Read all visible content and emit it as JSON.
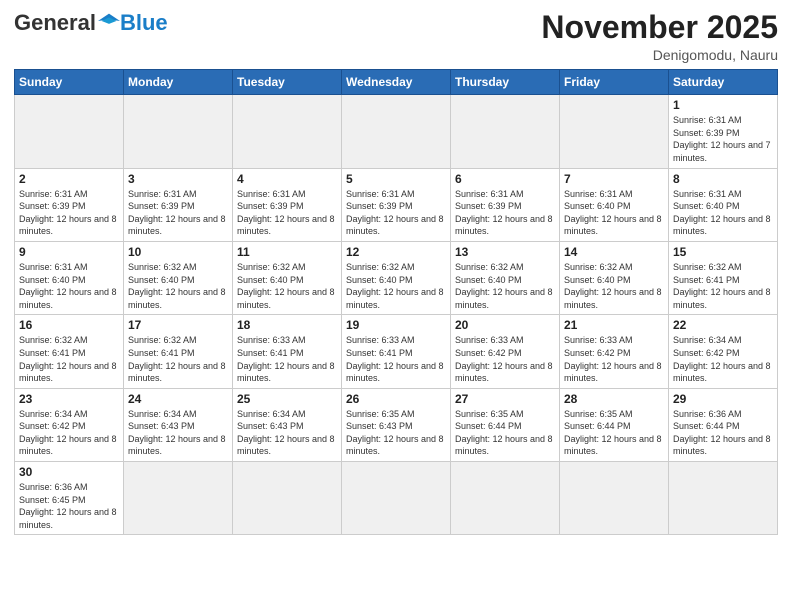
{
  "header": {
    "logo": {
      "general": "General",
      "blue": "Blue"
    },
    "title": "November 2025",
    "location": "Denigomodu, Nauru"
  },
  "weekdays": [
    "Sunday",
    "Monday",
    "Tuesday",
    "Wednesday",
    "Thursday",
    "Friday",
    "Saturday"
  ],
  "weeks": [
    [
      {
        "day": "",
        "info": ""
      },
      {
        "day": "",
        "info": ""
      },
      {
        "day": "",
        "info": ""
      },
      {
        "day": "",
        "info": ""
      },
      {
        "day": "",
        "info": ""
      },
      {
        "day": "",
        "info": ""
      },
      {
        "day": "1",
        "info": "Sunrise: 6:31 AM\nSunset: 6:39 PM\nDaylight: 12 hours\nand 7 minutes."
      }
    ],
    [
      {
        "day": "2",
        "info": "Sunrise: 6:31 AM\nSunset: 6:39 PM\nDaylight: 12 hours\nand 8 minutes."
      },
      {
        "day": "3",
        "info": "Sunrise: 6:31 AM\nSunset: 6:39 PM\nDaylight: 12 hours\nand 8 minutes."
      },
      {
        "day": "4",
        "info": "Sunrise: 6:31 AM\nSunset: 6:39 PM\nDaylight: 12 hours\nand 8 minutes."
      },
      {
        "day": "5",
        "info": "Sunrise: 6:31 AM\nSunset: 6:39 PM\nDaylight: 12 hours\nand 8 minutes."
      },
      {
        "day": "6",
        "info": "Sunrise: 6:31 AM\nSunset: 6:39 PM\nDaylight: 12 hours\nand 8 minutes."
      },
      {
        "day": "7",
        "info": "Sunrise: 6:31 AM\nSunset: 6:40 PM\nDaylight: 12 hours\nand 8 minutes."
      },
      {
        "day": "8",
        "info": "Sunrise: 6:31 AM\nSunset: 6:40 PM\nDaylight: 12 hours\nand 8 minutes."
      }
    ],
    [
      {
        "day": "9",
        "info": "Sunrise: 6:31 AM\nSunset: 6:40 PM\nDaylight: 12 hours\nand 8 minutes."
      },
      {
        "day": "10",
        "info": "Sunrise: 6:32 AM\nSunset: 6:40 PM\nDaylight: 12 hours\nand 8 minutes."
      },
      {
        "day": "11",
        "info": "Sunrise: 6:32 AM\nSunset: 6:40 PM\nDaylight: 12 hours\nand 8 minutes."
      },
      {
        "day": "12",
        "info": "Sunrise: 6:32 AM\nSunset: 6:40 PM\nDaylight: 12 hours\nand 8 minutes."
      },
      {
        "day": "13",
        "info": "Sunrise: 6:32 AM\nSunset: 6:40 PM\nDaylight: 12 hours\nand 8 minutes."
      },
      {
        "day": "14",
        "info": "Sunrise: 6:32 AM\nSunset: 6:40 PM\nDaylight: 12 hours\nand 8 minutes."
      },
      {
        "day": "15",
        "info": "Sunrise: 6:32 AM\nSunset: 6:41 PM\nDaylight: 12 hours\nand 8 minutes."
      }
    ],
    [
      {
        "day": "16",
        "info": "Sunrise: 6:32 AM\nSunset: 6:41 PM\nDaylight: 12 hours\nand 8 minutes."
      },
      {
        "day": "17",
        "info": "Sunrise: 6:32 AM\nSunset: 6:41 PM\nDaylight: 12 hours\nand 8 minutes."
      },
      {
        "day": "18",
        "info": "Sunrise: 6:33 AM\nSunset: 6:41 PM\nDaylight: 12 hours\nand 8 minutes."
      },
      {
        "day": "19",
        "info": "Sunrise: 6:33 AM\nSunset: 6:41 PM\nDaylight: 12 hours\nand 8 minutes."
      },
      {
        "day": "20",
        "info": "Sunrise: 6:33 AM\nSunset: 6:42 PM\nDaylight: 12 hours\nand 8 minutes."
      },
      {
        "day": "21",
        "info": "Sunrise: 6:33 AM\nSunset: 6:42 PM\nDaylight: 12 hours\nand 8 minutes."
      },
      {
        "day": "22",
        "info": "Sunrise: 6:34 AM\nSunset: 6:42 PM\nDaylight: 12 hours\nand 8 minutes."
      }
    ],
    [
      {
        "day": "23",
        "info": "Sunrise: 6:34 AM\nSunset: 6:42 PM\nDaylight: 12 hours\nand 8 minutes."
      },
      {
        "day": "24",
        "info": "Sunrise: 6:34 AM\nSunset: 6:43 PM\nDaylight: 12 hours\nand 8 minutes."
      },
      {
        "day": "25",
        "info": "Sunrise: 6:34 AM\nSunset: 6:43 PM\nDaylight: 12 hours\nand 8 minutes."
      },
      {
        "day": "26",
        "info": "Sunrise: 6:35 AM\nSunset: 6:43 PM\nDaylight: 12 hours\nand 8 minutes."
      },
      {
        "day": "27",
        "info": "Sunrise: 6:35 AM\nSunset: 6:44 PM\nDaylight: 12 hours\nand 8 minutes."
      },
      {
        "day": "28",
        "info": "Sunrise: 6:35 AM\nSunset: 6:44 PM\nDaylight: 12 hours\nand 8 minutes."
      },
      {
        "day": "29",
        "info": "Sunrise: 6:36 AM\nSunset: 6:44 PM\nDaylight: 12 hours\nand 8 minutes."
      }
    ],
    [
      {
        "day": "30",
        "info": "Sunrise: 6:36 AM\nSunset: 6:45 PM\nDaylight: 12 hours\nand 8 minutes."
      },
      {
        "day": "",
        "info": ""
      },
      {
        "day": "",
        "info": ""
      },
      {
        "day": "",
        "info": ""
      },
      {
        "day": "",
        "info": ""
      },
      {
        "day": "",
        "info": ""
      },
      {
        "day": "",
        "info": ""
      }
    ]
  ]
}
